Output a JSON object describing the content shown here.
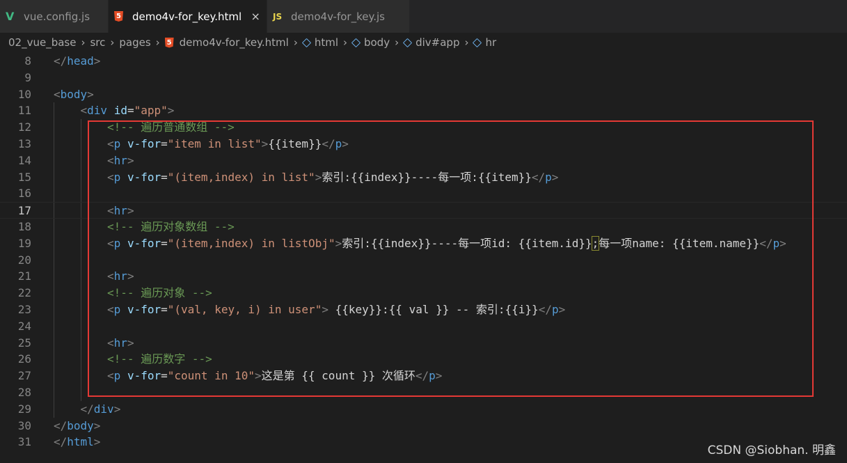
{
  "tabs": [
    {
      "label": "vue.config.js",
      "icon": "vue-icon",
      "glyph": "V"
    },
    {
      "label": "demo4v-for_key.html",
      "icon": "html5-icon",
      "glyph": "5",
      "close": "×",
      "active": true
    },
    {
      "label": "demo4v-for_key.js",
      "icon": "js-icon",
      "glyph": "JS"
    }
  ],
  "breadcrumb": [
    "02_vue_base",
    "src",
    "pages",
    "demo4v-for_key.html",
    "html",
    "body",
    "div#app",
    "hr"
  ],
  "breadcrumb_sep": "›",
  "lines": [
    {
      "n": "8",
      "tokens": [
        [
          "t",
          "</"
        ],
        [
          "tg",
          "head"
        ],
        [
          "t",
          ">"
        ]
      ]
    },
    {
      "n": "9",
      "tokens": []
    },
    {
      "n": "10",
      "tokens": [
        [
          "t",
          "<"
        ],
        [
          "tg",
          "body"
        ],
        [
          "t",
          ">"
        ]
      ]
    },
    {
      "n": "11",
      "tokens": [
        [
          "t",
          "<"
        ],
        [
          "tg",
          "div"
        ],
        [
          "tx",
          " "
        ],
        [
          "at",
          "id"
        ],
        [
          "tx",
          "="
        ],
        [
          "st",
          "\"app\""
        ],
        [
          "t",
          ">"
        ]
      ]
    },
    {
      "n": "12",
      "tokens": [
        [
          "cm",
          "<!-- 遍历普通数组 -->"
        ]
      ]
    },
    {
      "n": "13",
      "tokens": [
        [
          "t",
          "<"
        ],
        [
          "tg",
          "p"
        ],
        [
          "tx",
          " "
        ],
        [
          "at",
          "v-for"
        ],
        [
          "tx",
          "="
        ],
        [
          "st",
          "\"item in list\""
        ],
        [
          "t",
          ">"
        ],
        [
          "tx",
          "{{item}}"
        ],
        [
          "t",
          "</"
        ],
        [
          "tg",
          "p"
        ],
        [
          "t",
          ">"
        ]
      ]
    },
    {
      "n": "14",
      "tokens": [
        [
          "t",
          "<"
        ],
        [
          "tg",
          "hr"
        ],
        [
          "t",
          ">"
        ]
      ]
    },
    {
      "n": "15",
      "tokens": [
        [
          "t",
          "<"
        ],
        [
          "tg",
          "p"
        ],
        [
          "tx",
          " "
        ],
        [
          "at",
          "v-for"
        ],
        [
          "tx",
          "="
        ],
        [
          "st",
          "\"(item,index) in list\""
        ],
        [
          "t",
          ">"
        ],
        [
          "tx",
          "索引:{{index}}----每一项:{{item}}"
        ],
        [
          "t",
          "</"
        ],
        [
          "tg",
          "p"
        ],
        [
          "t",
          ">"
        ]
      ]
    },
    {
      "n": "16",
      "tokens": []
    },
    {
      "n": "17",
      "tokens": [
        [
          "t",
          "<"
        ],
        [
          "tg",
          "hr"
        ],
        [
          "t",
          ">"
        ]
      ]
    },
    {
      "n": "18",
      "tokens": [
        [
          "cm",
          "<!-- 遍历对象数组 -->"
        ]
      ]
    },
    {
      "n": "19",
      "tokens": [
        [
          "t",
          "<"
        ],
        [
          "tg",
          "p"
        ],
        [
          "tx",
          " "
        ],
        [
          "at",
          "v-for"
        ],
        [
          "tx",
          "="
        ],
        [
          "st",
          "\"(item,index) in listObj\""
        ],
        [
          "t",
          ">"
        ],
        [
          "tx",
          "索引:{{index}}----每一项id: {{item.id}}"
        ],
        [
          "br",
          ";"
        ],
        [
          "tx",
          "每一项name: {{item.name}}"
        ],
        [
          "t",
          "</"
        ],
        [
          "tg",
          "p"
        ],
        [
          "t",
          ">"
        ]
      ]
    },
    {
      "n": "20",
      "tokens": []
    },
    {
      "n": "21",
      "tokens": [
        [
          "t",
          "<"
        ],
        [
          "tg",
          "hr"
        ],
        [
          "t",
          ">"
        ]
      ]
    },
    {
      "n": "22",
      "tokens": [
        [
          "cm",
          "<!-- 遍历对象 -->"
        ]
      ]
    },
    {
      "n": "23",
      "tokens": [
        [
          "t",
          "<"
        ],
        [
          "tg",
          "p"
        ],
        [
          "tx",
          " "
        ],
        [
          "at",
          "v-for"
        ],
        [
          "tx",
          "="
        ],
        [
          "st",
          "\"(val, key, i) in user\""
        ],
        [
          "t",
          ">"
        ],
        [
          "tx",
          " {{key}}:{{ val }} -- 索引:{{i}}"
        ],
        [
          "t",
          "</"
        ],
        [
          "tg",
          "p"
        ],
        [
          "t",
          ">"
        ]
      ]
    },
    {
      "n": "24",
      "tokens": []
    },
    {
      "n": "25",
      "tokens": [
        [
          "t",
          "<"
        ],
        [
          "tg",
          "hr"
        ],
        [
          "t",
          ">"
        ]
      ]
    },
    {
      "n": "26",
      "tokens": [
        [
          "cm",
          "<!-- 遍历数字 -->"
        ]
      ]
    },
    {
      "n": "27",
      "tokens": [
        [
          "t",
          "<"
        ],
        [
          "tg",
          "p"
        ],
        [
          "tx",
          " "
        ],
        [
          "at",
          "v-for"
        ],
        [
          "tx",
          "="
        ],
        [
          "st",
          "\"count in 10\""
        ],
        [
          "t",
          ">"
        ],
        [
          "tx",
          "这是第 {{ count }} 次循环"
        ],
        [
          "t",
          "</"
        ],
        [
          "tg",
          "p"
        ],
        [
          "t",
          ">"
        ]
      ]
    },
    {
      "n": "28",
      "tokens": []
    },
    {
      "n": "29",
      "tokens": [
        [
          "t",
          "</"
        ],
        [
          "tg",
          "div"
        ],
        [
          "t",
          ">"
        ]
      ]
    },
    {
      "n": "30",
      "tokens": [
        [
          "t",
          "</"
        ],
        [
          "tg",
          "body"
        ],
        [
          "t",
          ">"
        ]
      ]
    },
    {
      "n": "31",
      "tokens": [
        [
          "t",
          "</"
        ],
        [
          "tg",
          "html"
        ],
        [
          "t",
          ">"
        ]
      ]
    }
  ],
  "current_line": "17",
  "watermark": "CSDN @Siobhan. 明鑫",
  "colors": {
    "tag": "#569cd6",
    "attr": "#9cdcfe",
    "string": "#ce9178",
    "comment": "#6a9955",
    "highlight_box": "#e53935"
  }
}
